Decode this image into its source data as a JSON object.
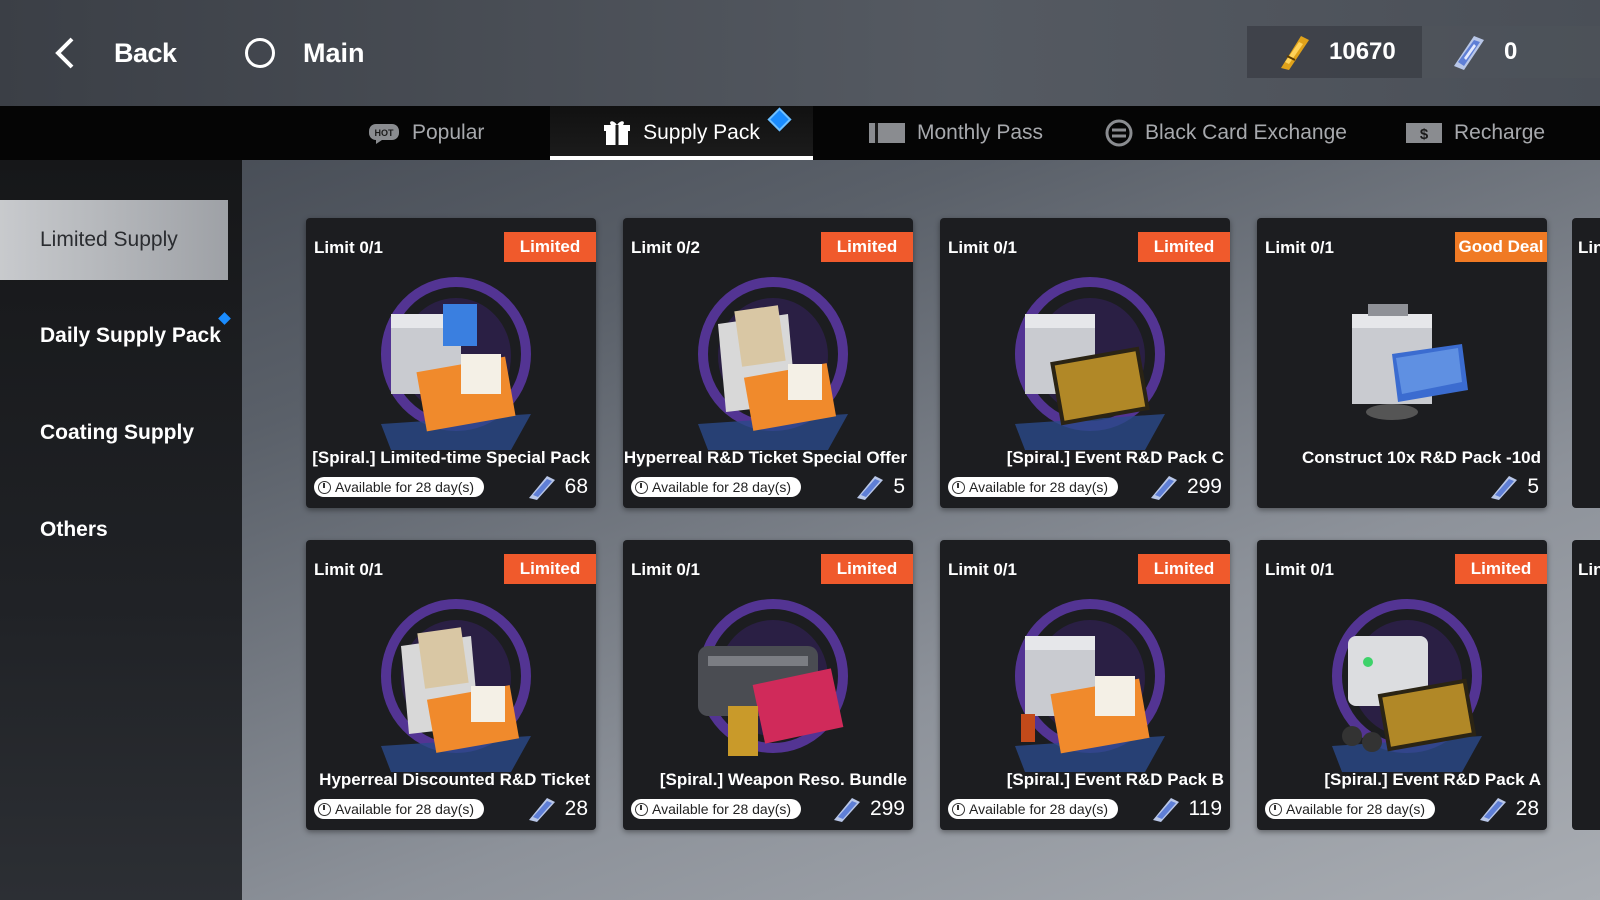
{
  "header": {
    "back_label": "Back",
    "main_label": "Main",
    "currencies": [
      {
        "icon": "gold-ticket-icon",
        "value": "10670"
      },
      {
        "icon": "blue-crystal-icon",
        "value": "0"
      }
    ]
  },
  "tabs": [
    {
      "label": "Popular",
      "icon": "hot-icon",
      "active": false
    },
    {
      "label": "Supply Pack",
      "icon": "gift-icon",
      "active": true
    },
    {
      "label": "Monthly Pass",
      "icon": "pass-card-icon",
      "active": false
    },
    {
      "label": "Black Card Exchange",
      "icon": "exchange-icon",
      "active": false
    },
    {
      "label": "Recharge",
      "icon": "dollar-bill-icon",
      "active": false
    }
  ],
  "sidebar": {
    "items": [
      {
        "label": "Limited Supply",
        "active": true
      },
      {
        "label": "Daily Supply Pack",
        "active": false
      },
      {
        "label": "Coating Supply",
        "active": false
      },
      {
        "label": "Others",
        "active": false
      }
    ]
  },
  "cards": [
    {
      "limit": "Limit 0/1",
      "badge": "Limited",
      "name": "[Spiral.] Limited-time Special Pack",
      "availability": "Available for 28 day(s)",
      "price": "68"
    },
    {
      "limit": "Limit 0/2",
      "badge": "Limited",
      "name": "Hyperreal R&D Ticket Special Offer",
      "availability": "Available for 28 day(s)",
      "price": "5"
    },
    {
      "limit": "Limit 0/1",
      "badge": "Limited",
      "name": "[Spiral.] Event R&D Pack C",
      "availability": "Available for 28 day(s)",
      "price": "299"
    },
    {
      "limit": "Limit 0/1",
      "badge": "Good Deal",
      "name": "Construct 10x R&D Pack -10d",
      "availability": "",
      "price": "5"
    },
    {
      "limit": "Limit 0/1",
      "badge": "Limited",
      "name": "Hyperreal Discounted R&D Ticket",
      "availability": "Available for 28 day(s)",
      "price": "28"
    },
    {
      "limit": "Limit 0/1",
      "badge": "Limited",
      "name": "[Spiral.] Weapon Reso. Bundle",
      "availability": "Available for 28 day(s)",
      "price": "299"
    },
    {
      "limit": "Limit 0/1",
      "badge": "Limited",
      "name": "[Spiral.] Event R&D Pack B",
      "availability": "Available for 28 day(s)",
      "price": "119"
    },
    {
      "limit": "Limit 0/1",
      "badge": "Limited",
      "name": "[Spiral.] Event R&D Pack A",
      "availability": "Available for 28 day(s)",
      "price": "28"
    }
  ],
  "peek_cards": [
    {
      "text": "Lin"
    },
    {
      "text": "Lin"
    }
  ],
  "colors": {
    "badge_limited": "#f05a2c",
    "badge_deal": "#f07a24",
    "accent_blue": "#1a8cff"
  }
}
